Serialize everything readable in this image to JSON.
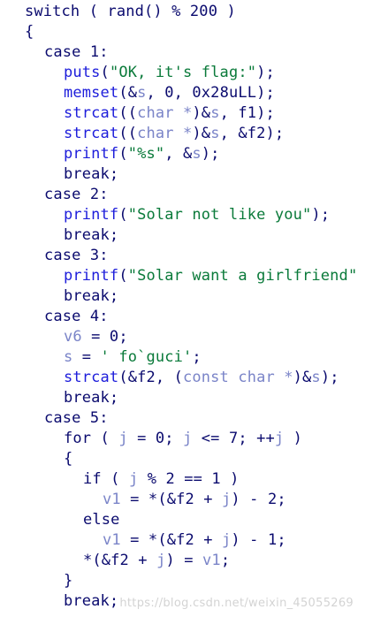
{
  "colors": {
    "background": "#ffffff",
    "default_text": "#0a0a6e",
    "function_name": "#1d1ddb",
    "string_literal": "#0a7a3a",
    "local_variable": "#7a84c8",
    "type_keyword": "#7a84c8",
    "watermark": "#cfcfcf"
  },
  "lines": [
    {
      "indent": 1,
      "tokens": [
        {
          "t": "switch ( rand() % 200 )",
          "c": "default"
        }
      ]
    },
    {
      "indent": 1,
      "tokens": [
        {
          "t": "{",
          "c": "default"
        }
      ]
    },
    {
      "indent": 2,
      "tokens": [
        {
          "t": "case 1:",
          "c": "default"
        }
      ]
    },
    {
      "indent": 3,
      "tokens": [
        {
          "t": "puts",
          "c": "fn"
        },
        {
          "t": "(",
          "c": "default"
        },
        {
          "t": "\"OK, it's flag:\"",
          "c": "str"
        },
        {
          "t": ");",
          "c": "default"
        }
      ]
    },
    {
      "indent": 3,
      "tokens": [
        {
          "t": "memset",
          "c": "fn"
        },
        {
          "t": "(&",
          "c": "default"
        },
        {
          "t": "s",
          "c": "var"
        },
        {
          "t": ", 0, 0x28uLL);",
          "c": "default"
        }
      ]
    },
    {
      "indent": 3,
      "tokens": [
        {
          "t": "strcat",
          "c": "fn"
        },
        {
          "t": "((",
          "c": "default"
        },
        {
          "t": "char *",
          "c": "type"
        },
        {
          "t": ")&",
          "c": "default"
        },
        {
          "t": "s",
          "c": "var"
        },
        {
          "t": ", f1);",
          "c": "default"
        }
      ]
    },
    {
      "indent": 3,
      "tokens": [
        {
          "t": "strcat",
          "c": "fn"
        },
        {
          "t": "((",
          "c": "default"
        },
        {
          "t": "char *",
          "c": "type"
        },
        {
          "t": ")&",
          "c": "default"
        },
        {
          "t": "s",
          "c": "var"
        },
        {
          "t": ", &f2);",
          "c": "default"
        }
      ]
    },
    {
      "indent": 3,
      "tokens": [
        {
          "t": "printf",
          "c": "fn"
        },
        {
          "t": "(",
          "c": "default"
        },
        {
          "t": "\"%s\"",
          "c": "str"
        },
        {
          "t": ", &",
          "c": "default"
        },
        {
          "t": "s",
          "c": "var"
        },
        {
          "t": ");",
          "c": "default"
        }
      ]
    },
    {
      "indent": 3,
      "tokens": [
        {
          "t": "break;",
          "c": "default"
        }
      ]
    },
    {
      "indent": 2,
      "tokens": [
        {
          "t": "case 2:",
          "c": "default"
        }
      ]
    },
    {
      "indent": 3,
      "tokens": [
        {
          "t": "printf",
          "c": "fn"
        },
        {
          "t": "(",
          "c": "default"
        },
        {
          "t": "\"Solar not like you\"",
          "c": "str"
        },
        {
          "t": ");",
          "c": "default"
        }
      ]
    },
    {
      "indent": 3,
      "tokens": [
        {
          "t": "break;",
          "c": "default"
        }
      ]
    },
    {
      "indent": 2,
      "tokens": [
        {
          "t": "case 3:",
          "c": "default"
        }
      ]
    },
    {
      "indent": 3,
      "tokens": [
        {
          "t": "printf",
          "c": "fn"
        },
        {
          "t": "(",
          "c": "default"
        },
        {
          "t": "\"Solar want a girlfriend\"",
          "c": "str"
        }
      ]
    },
    {
      "indent": 3,
      "tokens": [
        {
          "t": "break;",
          "c": "default"
        }
      ]
    },
    {
      "indent": 2,
      "tokens": [
        {
          "t": "case 4:",
          "c": "default"
        }
      ]
    },
    {
      "indent": 3,
      "tokens": [
        {
          "t": "v6",
          "c": "var"
        },
        {
          "t": " = 0;",
          "c": "default"
        }
      ]
    },
    {
      "indent": 3,
      "tokens": [
        {
          "t": "s",
          "c": "var"
        },
        {
          "t": " = ",
          "c": "default"
        },
        {
          "t": "' fo`guci'",
          "c": "str"
        },
        {
          "t": ";",
          "c": "default"
        }
      ]
    },
    {
      "indent": 3,
      "tokens": [
        {
          "t": "strcat",
          "c": "fn"
        },
        {
          "t": "(&f2, (",
          "c": "default"
        },
        {
          "t": "const char *",
          "c": "type"
        },
        {
          "t": ")&",
          "c": "default"
        },
        {
          "t": "s",
          "c": "var"
        },
        {
          "t": ");",
          "c": "default"
        }
      ]
    },
    {
      "indent": 3,
      "tokens": [
        {
          "t": "break;",
          "c": "default"
        }
      ]
    },
    {
      "indent": 2,
      "tokens": [
        {
          "t": "case 5:",
          "c": "default"
        }
      ]
    },
    {
      "indent": 3,
      "tokens": [
        {
          "t": "for ( ",
          "c": "default"
        },
        {
          "t": "j",
          "c": "var"
        },
        {
          "t": " = 0; ",
          "c": "default"
        },
        {
          "t": "j",
          "c": "var"
        },
        {
          "t": " <= 7; ++",
          "c": "default"
        },
        {
          "t": "j",
          "c": "var"
        },
        {
          "t": " )",
          "c": "default"
        }
      ]
    },
    {
      "indent": 3,
      "tokens": [
        {
          "t": "{",
          "c": "default"
        }
      ]
    },
    {
      "indent": 4,
      "tokens": [
        {
          "t": "if ( ",
          "c": "default"
        },
        {
          "t": "j",
          "c": "var"
        },
        {
          "t": " % 2 == 1 )",
          "c": "default"
        }
      ]
    },
    {
      "indent": 5,
      "tokens": [
        {
          "t": "v1",
          "c": "var"
        },
        {
          "t": " = *(&f2 + ",
          "c": "default"
        },
        {
          "t": "j",
          "c": "var"
        },
        {
          "t": ") - 2;",
          "c": "default"
        }
      ]
    },
    {
      "indent": 4,
      "tokens": [
        {
          "t": "else",
          "c": "default"
        }
      ]
    },
    {
      "indent": 5,
      "tokens": [
        {
          "t": "v1",
          "c": "var"
        },
        {
          "t": " = *(&f2 + ",
          "c": "default"
        },
        {
          "t": "j",
          "c": "var"
        },
        {
          "t": ") - 1;",
          "c": "default"
        }
      ]
    },
    {
      "indent": 4,
      "tokens": [
        {
          "t": "*(&f2 + ",
          "c": "default"
        },
        {
          "t": "j",
          "c": "var"
        },
        {
          "t": ") = ",
          "c": "default"
        },
        {
          "t": "v1",
          "c": "var"
        },
        {
          "t": ";",
          "c": "default"
        }
      ]
    },
    {
      "indent": 3,
      "tokens": [
        {
          "t": "}",
          "c": "default"
        }
      ]
    },
    {
      "indent": 3,
      "tokens": [
        {
          "t": "break;",
          "c": "default"
        }
      ]
    }
  ],
  "watermark": "https://blog.csdn.net/weixin_45055269"
}
